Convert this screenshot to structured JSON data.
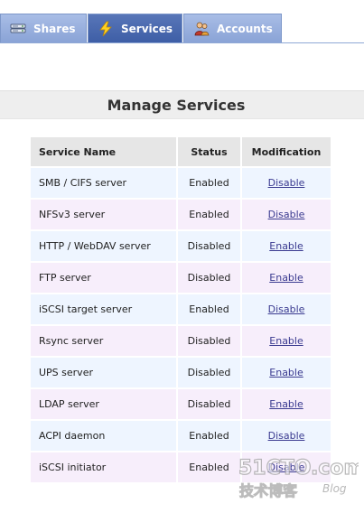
{
  "tabs": [
    {
      "label": "Shares",
      "icon": "drive-icon",
      "active": false
    },
    {
      "label": "Services",
      "icon": "lightning-icon",
      "active": true
    },
    {
      "label": "Accounts",
      "icon": "users-icon",
      "active": false
    }
  ],
  "section": {
    "title": "Manage Services"
  },
  "table": {
    "headers": {
      "name": "Service Name",
      "status": "Status",
      "modification": "Modification"
    },
    "rows": [
      {
        "name": "SMB / CIFS server",
        "status": "Enabled",
        "action": "Disable"
      },
      {
        "name": "NFSv3 server",
        "status": "Enabled",
        "action": "Disable"
      },
      {
        "name": "HTTP / WebDAV server",
        "status": "Disabled",
        "action": "Enable"
      },
      {
        "name": "FTP server",
        "status": "Disabled",
        "action": "Enable"
      },
      {
        "name": "iSCSI target server",
        "status": "Enabled",
        "action": "Disable"
      },
      {
        "name": "Rsync server",
        "status": "Disabled",
        "action": "Enable"
      },
      {
        "name": "UPS server",
        "status": "Disabled",
        "action": "Enable"
      },
      {
        "name": "LDAP server",
        "status": "Disabled",
        "action": "Enable"
      },
      {
        "name": "ACPI daemon",
        "status": "Enabled",
        "action": "Disable"
      },
      {
        "name": "iSCSI initiator",
        "status": "Enabled",
        "action": "Disable"
      }
    ]
  },
  "watermark": {
    "brand": "51CTO.com",
    "subtitle": "技术博客",
    "blog": "Blog"
  },
  "colors": {
    "active_tab": "#4462a8",
    "inactive_tab": "#98afdd",
    "row_even": "#eef5ff",
    "row_odd": "#f7eefb",
    "header_cell": "#e6e6e6",
    "link": "#3a3a90"
  }
}
